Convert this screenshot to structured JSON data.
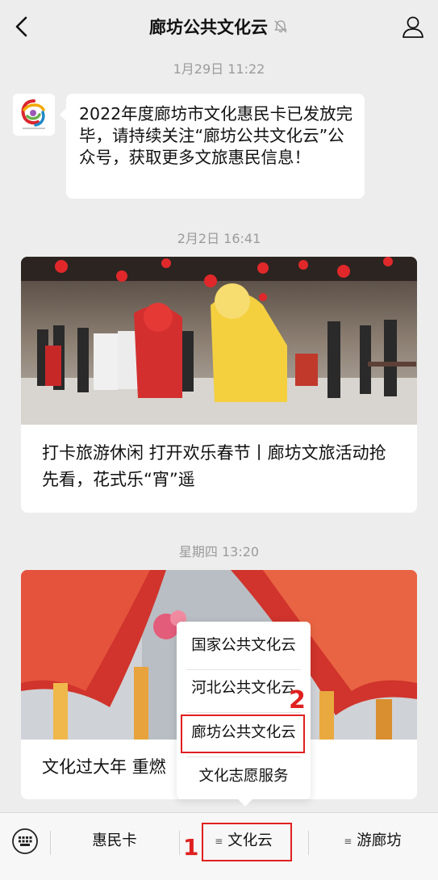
{
  "header": {
    "title": "廊坊公共文化云"
  },
  "messages": {
    "text_msg": {
      "timestamp": "1月29日 11:22",
      "text": "2022年度廊坊市文化惠民卡已发放完毕，请持续关注“廊坊公共文化云”公众号，获取更多文旅惠民信息！"
    },
    "article1": {
      "timestamp": "2月2日 16:41",
      "title": "打卡旅游休闲 打开欢乐春节丨廊坊文旅活动抢先看，花式乐“宵”遥"
    },
    "article2": {
      "timestamp": "星期四 13:20",
      "title": "文化过大年 重燃"
    }
  },
  "popup_menu": {
    "items": [
      "国家公共文化云",
      "河北公共文化云",
      "廊坊公共文化云",
      "文化志愿服务"
    ]
  },
  "bottom_bar": {
    "tabs": [
      "惠民卡",
      "文化云",
      "游廊坊"
    ]
  },
  "annotations": {
    "step1": "1",
    "step2": "2"
  },
  "colors": {
    "background": "#ededed",
    "annotation": "#e02020",
    "bubble": "#ffffff"
  }
}
